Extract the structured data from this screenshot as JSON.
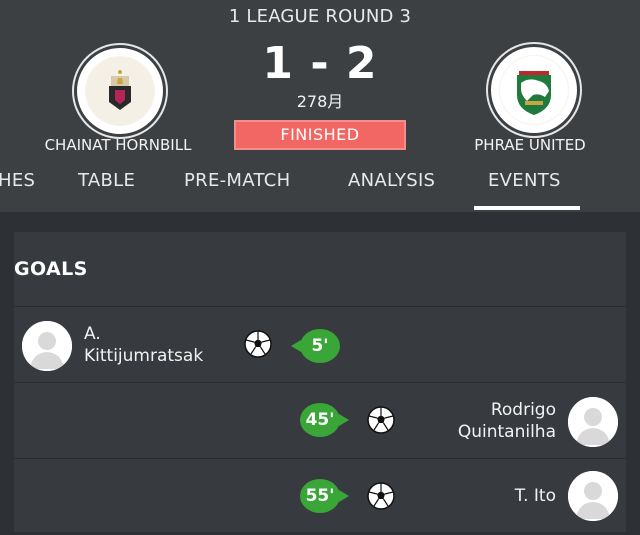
{
  "match": {
    "round": "1 LEAGUE ROUND 3",
    "home_team": "CHAINAT HORNBILL",
    "away_team": "PHRAE UNITED",
    "score": "1 - 2",
    "attendance": "278月",
    "status": "FINISHED"
  },
  "tabs": [
    {
      "label": "HES"
    },
    {
      "label": "TABLE"
    },
    {
      "label": "PRE-MATCH"
    },
    {
      "label": "ANALYSIS"
    },
    {
      "label": "EVENTS",
      "active": true
    }
  ],
  "goals": {
    "title": "GOALS",
    "events": [
      {
        "side": "home",
        "player": "A. Kittijumratsak",
        "player_line1": "A.",
        "player_line2": "Kittijumratsak",
        "minute": "5'"
      },
      {
        "side": "away",
        "player": "Rodrigo Quintanilha",
        "player_line1": "Rodrigo",
        "player_line2": "Quintanilha",
        "minute": "45'"
      },
      {
        "side": "away",
        "player": "T. Ito",
        "player_line1": "T. Ito",
        "minute": "55'"
      }
    ]
  },
  "colors": {
    "header_bg": "#3c4043",
    "page_bg": "#2d3135",
    "card_bg": "#373b3f",
    "status_red": "#f26763",
    "minute_green": "#3aa637"
  },
  "icons": {
    "goal": "soccer-ball-icon",
    "avatar": "player-avatar-icon"
  }
}
